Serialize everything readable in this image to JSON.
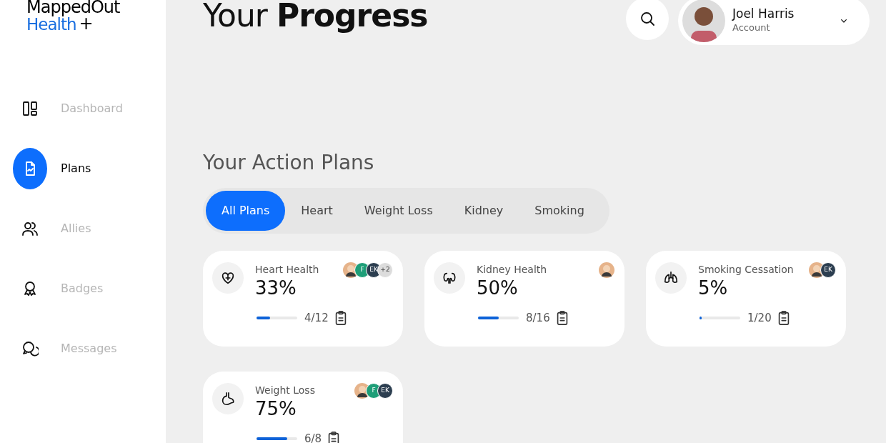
{
  "logo": {
    "line_1": "MappedOut",
    "line_2": "Health",
    "mark": "+"
  },
  "sidebar": {
    "items": [
      {
        "label": "Dashboard",
        "kind": "dashboard",
        "selected": false
      },
      {
        "label": "Plans",
        "kind": "plans",
        "selected": true
      },
      {
        "label": "Allies",
        "kind": "allies",
        "selected": false
      },
      {
        "label": "Badges",
        "kind": "badges",
        "selected": false
      },
      {
        "label": "Messages",
        "kind": "messages",
        "selected": false
      }
    ]
  },
  "header": {
    "title": "Your **Progress**",
    "user": {
      "name": "Joel Harris",
      "subtitle": "Account"
    }
  },
  "section_title": "Your Action Plans",
  "tabs": [
    {
      "label": "All Plans",
      "selected": true
    },
    {
      "label": "Heart",
      "selected": false
    },
    {
      "label": "Weight Loss",
      "selected": false
    },
    {
      "label": "Kidney",
      "selected": false
    },
    {
      "label": "Smoking",
      "selected": false
    }
  ],
  "plans": [
    {
      "title": "Heart Health",
      "kind": "heart",
      "percent": "33%",
      "level": 0.33,
      "count": "4/12",
      "allies": [
        {
          "kind": "photo"
        },
        {
          "kind": "initials",
          "text": "F",
          "color": "#1e9e78"
        },
        {
          "kind": "initials",
          "text": "EK",
          "color": "#2c3e50"
        },
        {
          "kind": "more",
          "text": "+2",
          "color": "#dcdcdc"
        }
      ]
    },
    {
      "title": "Kidney Health",
      "kind": "kidney",
      "percent": "50%",
      "level": 0.5,
      "count": "8/16",
      "allies": [
        {
          "kind": "photo"
        }
      ]
    },
    {
      "title": "Smoking Cessation",
      "kind": "lungs",
      "percent": "5%",
      "level": 0.05,
      "count": "1/20",
      "allies": [
        {
          "kind": "photo"
        },
        {
          "kind": "initials",
          "text": "EK",
          "color": "#2c3e50"
        }
      ]
    },
    {
      "title": "Weight Loss",
      "kind": "stomach",
      "percent": "75%",
      "level": 0.75,
      "count": "6/8",
      "allies": [
        {
          "kind": "photo"
        },
        {
          "kind": "initials",
          "text": "F",
          "color": "#1e9e78"
        },
        {
          "kind": "initials",
          "text": "EK",
          "color": "#2c3e50"
        }
      ]
    }
  ]
}
